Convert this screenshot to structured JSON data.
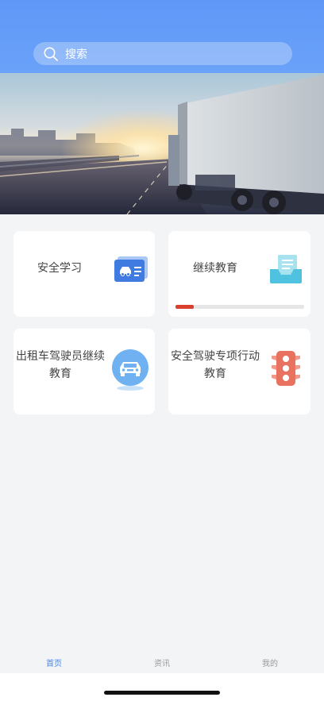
{
  "search": {
    "placeholder": "搜索"
  },
  "cards": [
    {
      "label": "安全学习",
      "icon": "driver-license-icon"
    },
    {
      "label": "继续教育",
      "icon": "document-tray-icon",
      "progress": 0.14
    },
    {
      "label_line1": "出租车驾驶员继续",
      "label_line2": "教育",
      "icon": "taxi-car-icon"
    },
    {
      "label_line1": "安全驾驶专项行动",
      "label_line2": "教育",
      "icon": "traffic-light-icon"
    }
  ],
  "tabbar": {
    "items": [
      {
        "label": "首页",
        "active": true
      },
      {
        "label": "资讯",
        "active": false
      },
      {
        "label": "我的",
        "active": false
      }
    ]
  },
  "colors": {
    "header": "#5f98f8",
    "accent": "#4a86e8",
    "progress": "#d9412e"
  }
}
